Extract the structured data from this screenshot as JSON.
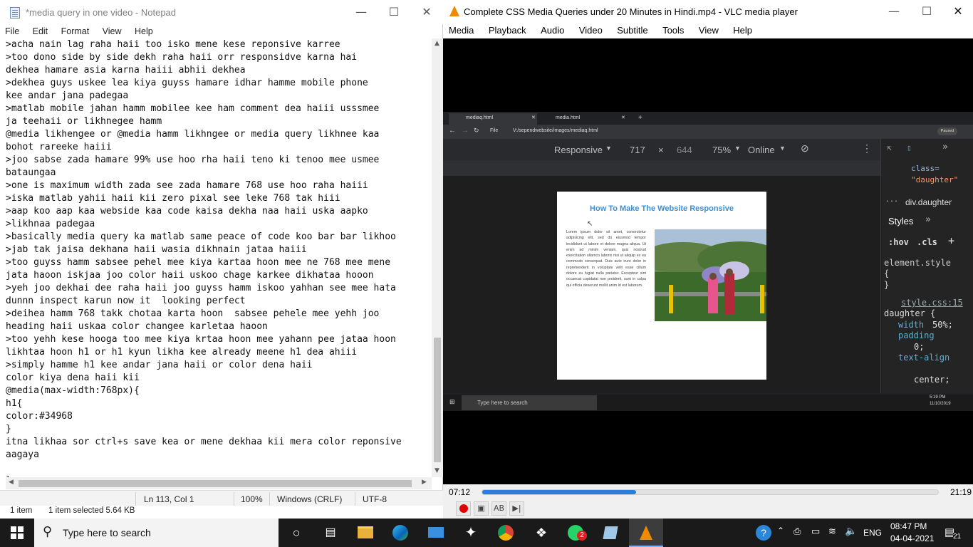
{
  "notepad": {
    "title": "*media query in one video - Notepad",
    "menu": [
      "File",
      "Edit",
      "Format",
      "View",
      "Help"
    ],
    "content": ">acha nain lag raha haii too isko mene kese reponsive karree\n>too dono side by side dekh raha haii orr responsidve karna hai\ndekhea hamare asia karna haiii abhii dekhea\n>dekhea guys uskee lea kiya guyss hamare idhar hamme mobile phone\nkee andar jana padegaa\n>matlab mobile jahan hamm mobilee kee ham comment dea haiii usssmee\nja teehaii or likhnegee hamm\n@media likhengee or @media hamm likhngee or media query likhnee kaa\nbohot rareeke haiii\n>joo sabse zada hamare 99% use hoo rha haii teno ki tenoo mee usmee\nbataungaa\n>one is maximum width zada see zada hamare 768 use hoo raha haiii\n>iska matlab yahii haii kii zero pixal see leke 768 tak hiii\n>aap koo aap kaa webside kaa code kaisa dekha naa haii uska aapko\n>likhnaa padegaa\n>basically media query ka matlab same peace of code koo bar bar likhoo\n>jab tak jaisa dekhana haii wasia dikhnain jataa haiii\n>too guyss hamm sabsee pehel mee kiya kartaa hoon mee ne 768 mee mene\njata haoon iskjaa joo color haii uskoo chage karkee dikhataa hooon\n>yeh joo dekhai dee raha haii joo guyss hamm iskoo yahhan see mee hata\ndunnn inspect karun now it  looking perfect\n>deihea hamm 768 takk chotaa karta hoon  sabsee pehele mee yehh joo\nheading haii uskaa color changee karletaa haoon\n>too yehh kese hooga too mee kiya krtaa hoon mee yahann pee jataa hoon\nlikhtaa hoon h1 or h1 kyun likha kee already meene h1 dea ahiii\n>simply hamme h1 kee andar jana haii or color dena haii\ncolor kiya dena haii kii\n@media(max-width:768px){\nh1{\ncolor:#34968\n}\nitna likhaa sor ctrl+s save kea or mene dekhaa kii mera color reponsive\naagaya\n\n}",
    "status": {
      "position": "Ln 113, Col 1",
      "zoom": "100%",
      "line_ending": "Windows (CRLF)",
      "encoding": "UTF-8"
    },
    "explorer_status": {
      "items": "1 item",
      "selected": "1 item selected  5.64 KB"
    }
  },
  "vlc": {
    "title": "Complete CSS Media Queries under 20 Minutes in Hindi.mp4 - VLC media player",
    "menu": [
      "Media",
      "Playback",
      "Audio",
      "Video",
      "Subtitle",
      "Tools",
      "View",
      "Help"
    ],
    "time_elapsed": "07:12",
    "time_total": "21:19",
    "progress_fraction": 0.338,
    "video": {
      "tabs": [
        "mediaq.html",
        "media.html"
      ],
      "url_prefix": "File",
      "url": "V:/sependwebsite/images/mediaq.html",
      "paused_badge": "Paused",
      "device": "Responsive",
      "width": "717",
      "times": "×",
      "height": "644",
      "zoom": "75%",
      "network": "Online",
      "page_heading": "How To Make The Website Responsive",
      "lorem": "Lorem ipsum dolor sit amet, consectetur adipisicing elit, sed do eiusmod tempor incididunt ut labore et dolore magna aliqua. Ut enim ad minim veniam, quis nostrud exercitation ullamco laboris nisi ut aliquip ex ea commodo consequat. Duis aute irure dolor in reprehenderit in voluptate velit esse cillum dolore eu fugiat nulla pariatur. Excepteur sint occaecat cupidatat non proident, sunt in culpa qui officia deserunt mollit anim id est laborum.",
      "devtools": {
        "class_attr": "class=",
        "class_value": "\"daughter\"",
        "breadcrumb_dots": "...",
        "breadcrumb": "div.daughter",
        "styles_tab": "Styles",
        "hov": ":hov",
        "cls": ".cls",
        "element_style": "element.style",
        "open_brace": "{",
        "close_brace": "}",
        "source": "style.css:15",
        "selector": "daughter {",
        "rule1_prop": "width",
        "rule1_val": "50%;",
        "rule2_prop": "padding",
        "rule2_val": "0;",
        "rule3_prop": "text-align",
        "rule3_val": "center;"
      },
      "rec_taskbar": {
        "search": "Type here to search",
        "time": "5:19 PM",
        "date": "11/10/2019"
      }
    }
  },
  "taskbar": {
    "search_placeholder": "Type here to search",
    "language": "ENG",
    "time": "08:47 PM",
    "date": "04-04-2021",
    "notification_count": "21",
    "whatsapp_badge": "2"
  },
  "colors": {
    "vlc_progress": "#2a7dde",
    "page_heading": "#3a90d8",
    "record_button": "#e00000"
  }
}
